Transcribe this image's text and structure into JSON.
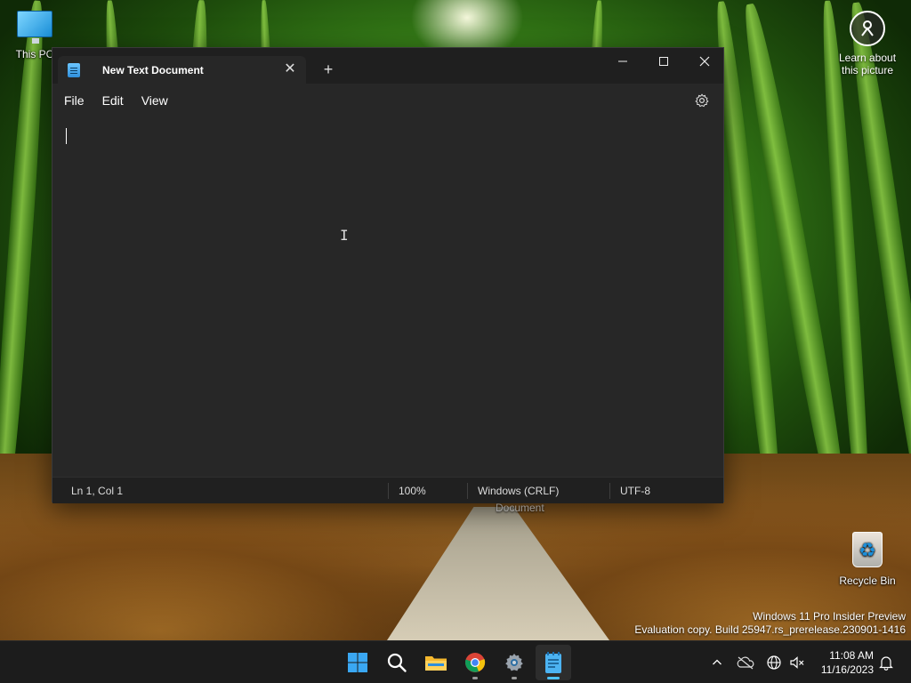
{
  "desktop": {
    "icons": [
      {
        "label": "This PC"
      },
      {
        "label": "Recycle Bin"
      }
    ],
    "learn_about_picture": "Learn about this picture",
    "watermark": {
      "line1": "Windows 11 Pro Insider Preview",
      "line2": "Evaluation copy. Build 25947.rs_prerelease.230901-1416"
    },
    "hover_tooltip": "Document"
  },
  "notepad": {
    "tab_title": "New Text Document",
    "menu": [
      "File",
      "Edit",
      "View"
    ],
    "editor_text": "",
    "status": {
      "position": "Ln 1, Col 1",
      "zoom": "100%",
      "line_ending": "Windows (CRLF)",
      "encoding": "UTF-8"
    }
  },
  "taskbar": {
    "apps": [
      "windows-start-icon",
      "search-icon",
      "file-explorer-icon",
      "chrome-icon",
      "settings-icon",
      "notepad-icon"
    ],
    "tray_icons": [
      "chevron-up-icon",
      "onedrive-icon",
      "network-icon",
      "volume-muted-icon",
      "notification-bell-icon"
    ],
    "clock": {
      "time": "11:08 AM",
      "date": "11/16/2023"
    }
  },
  "colors": {
    "window_bg": "#272727",
    "titlebar_bg": "#1f1f1f",
    "statusbar_bg": "#202020",
    "taskbar_bg": "#1c1c1c",
    "accent": "#4cc2ff"
  }
}
